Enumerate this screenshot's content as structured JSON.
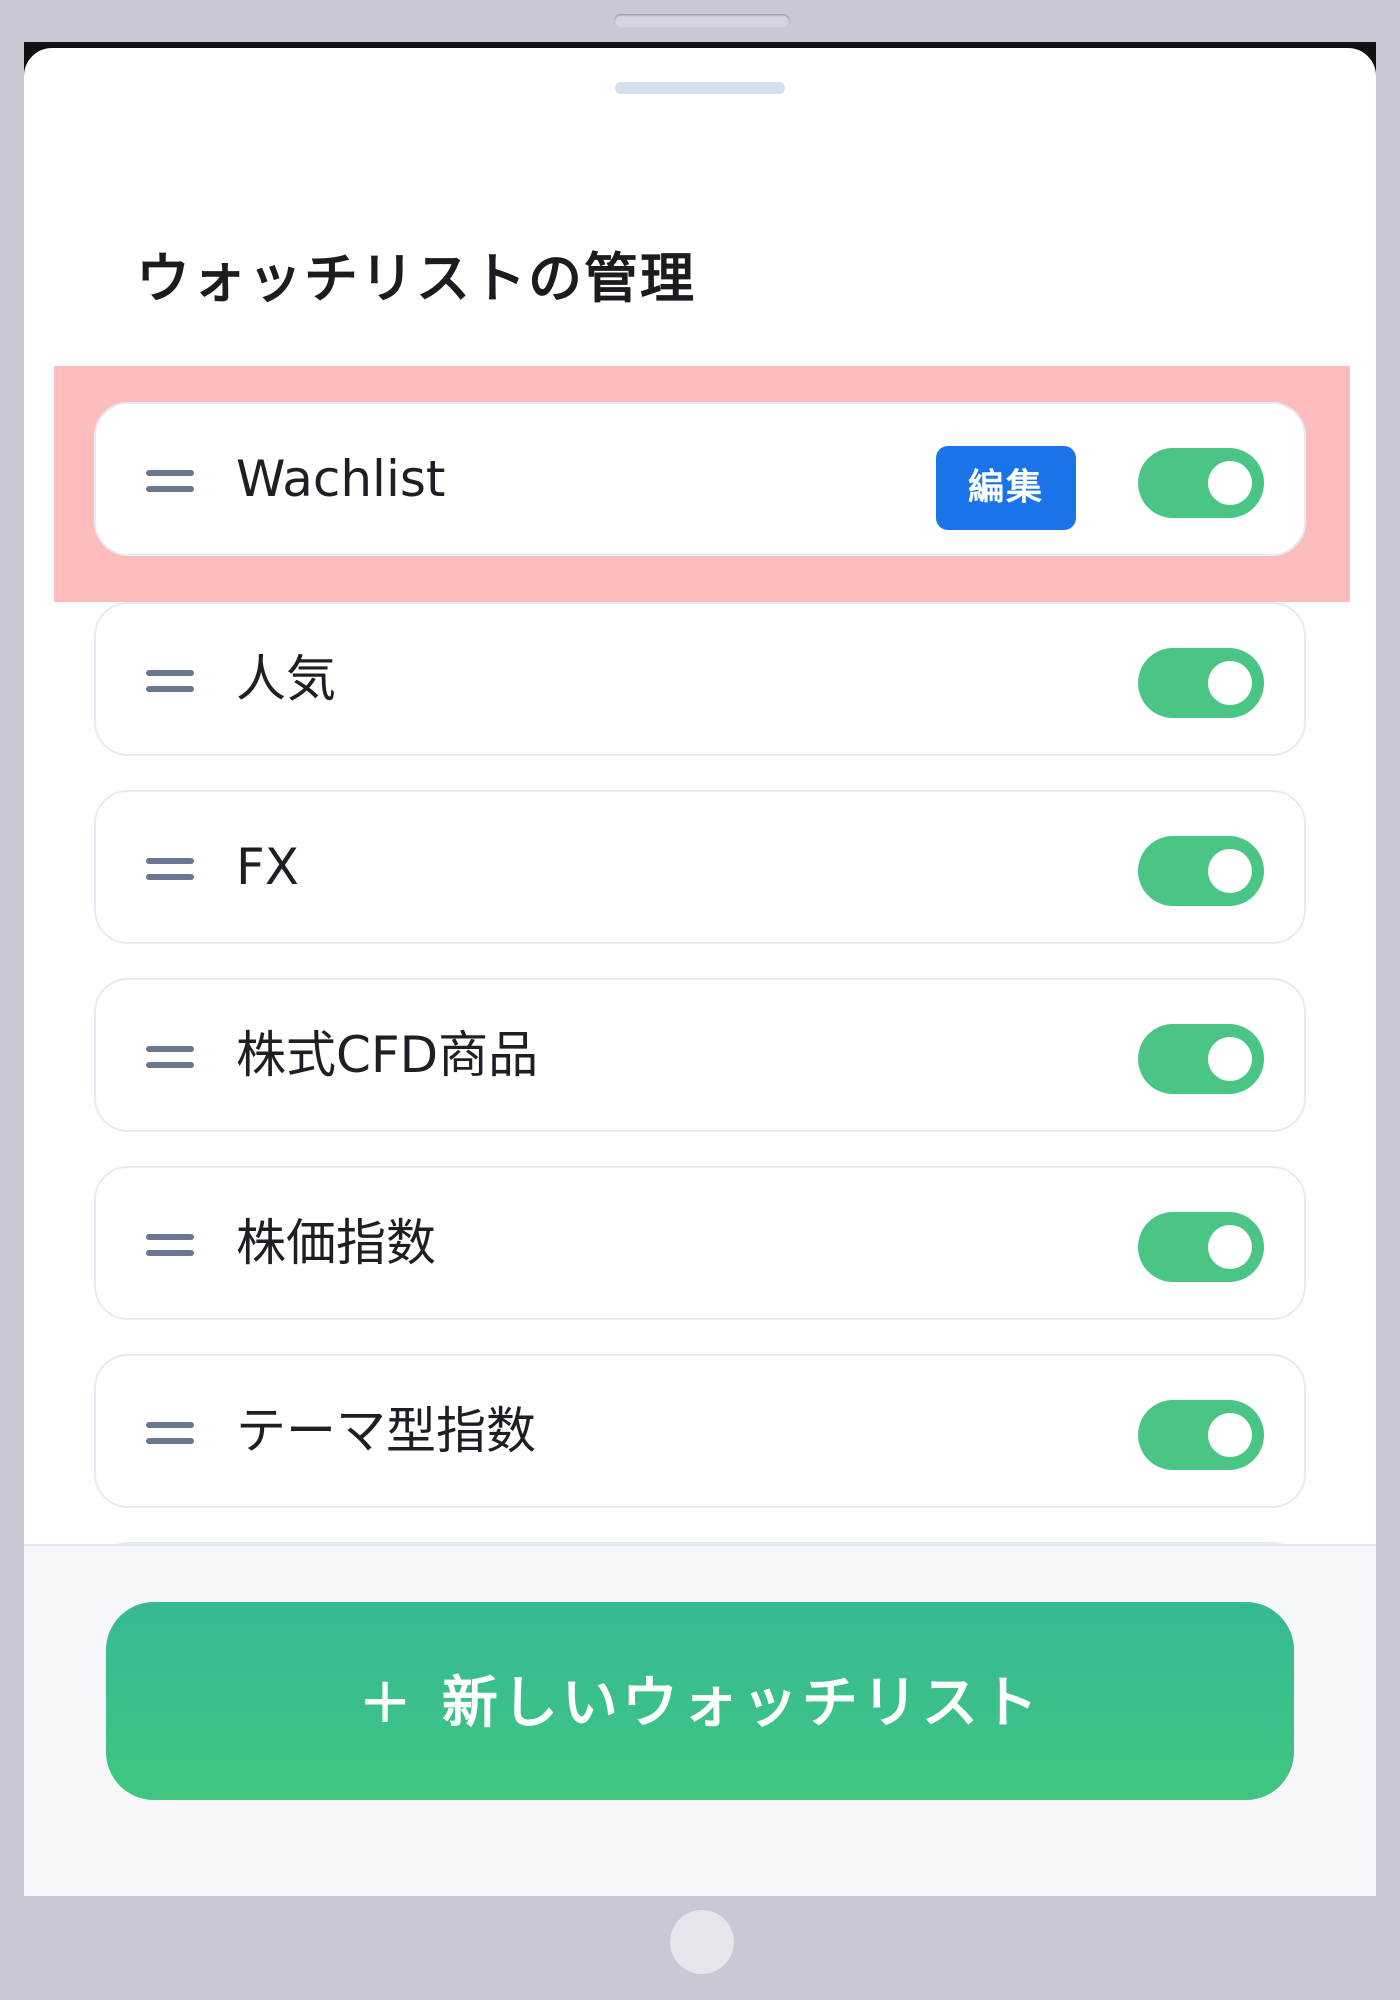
{
  "sheet": {
    "title": "ウォッチリストの管理"
  },
  "watchlists": [
    {
      "label": "Wachlist",
      "edit_label": "編集",
      "enabled": true
    },
    {
      "label": "人気",
      "enabled": true
    },
    {
      "label": "FX",
      "enabled": true
    },
    {
      "label": "株式CFD商品",
      "enabled": true
    },
    {
      "label": "株価指数",
      "enabled": true
    },
    {
      "label": "テーマ型指数",
      "enabled": true
    }
  ],
  "footer": {
    "new_button_icon": "+",
    "new_button_label": "新しいウォッチリスト"
  },
  "colors": {
    "toggle_on": "#4ac586",
    "edit_badge": "#1a73e8",
    "highlight": "#ffbcbd",
    "button_gradient_top": "#36b995",
    "button_gradient_bottom": "#40c680"
  },
  "icons": {
    "drag_handle": "drag-handle-icon",
    "plus": "plus-icon"
  }
}
